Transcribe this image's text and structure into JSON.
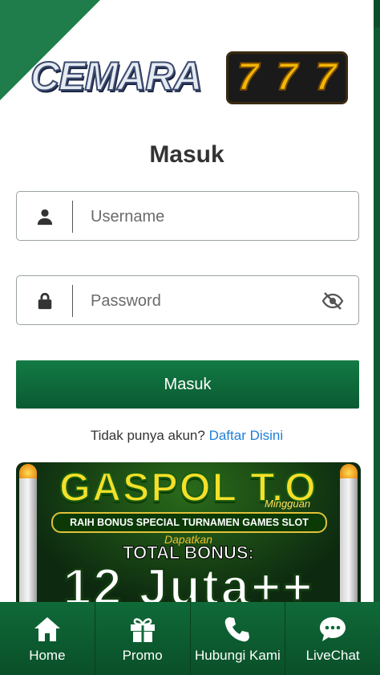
{
  "dialog": {
    "close_symbol": "✕"
  },
  "logo": {
    "text": "CEMARA",
    "digits": [
      "7",
      "7",
      "7"
    ]
  },
  "login": {
    "title": "Masuk",
    "username_placeholder": "Username",
    "password_placeholder": "Password",
    "submit_label": "Masuk",
    "signup_prompt": "Tidak punya akun?",
    "signup_link": "Daftar Disini"
  },
  "banner": {
    "title": "GASPOL T.O",
    "tag": "Mingguan",
    "subtitle": "RAIH BONUS SPECIAL TURNAMEN GAMES SLOT",
    "dapatkan": "Dapatkan",
    "total_bonus": "TOTAL BONUS:",
    "amount": "12 Juta++"
  },
  "bottom_nav": [
    {
      "label": "Home",
      "icon": "home-icon"
    },
    {
      "label": "Promo",
      "icon": "gift-icon"
    },
    {
      "label": "Hubungi Kami",
      "icon": "phone-icon"
    },
    {
      "label": "LiveChat",
      "icon": "chat-icon"
    }
  ],
  "colors": {
    "primary": "#0f6a38",
    "link": "#1f7fd6",
    "accent_gold": "#f2b705"
  }
}
